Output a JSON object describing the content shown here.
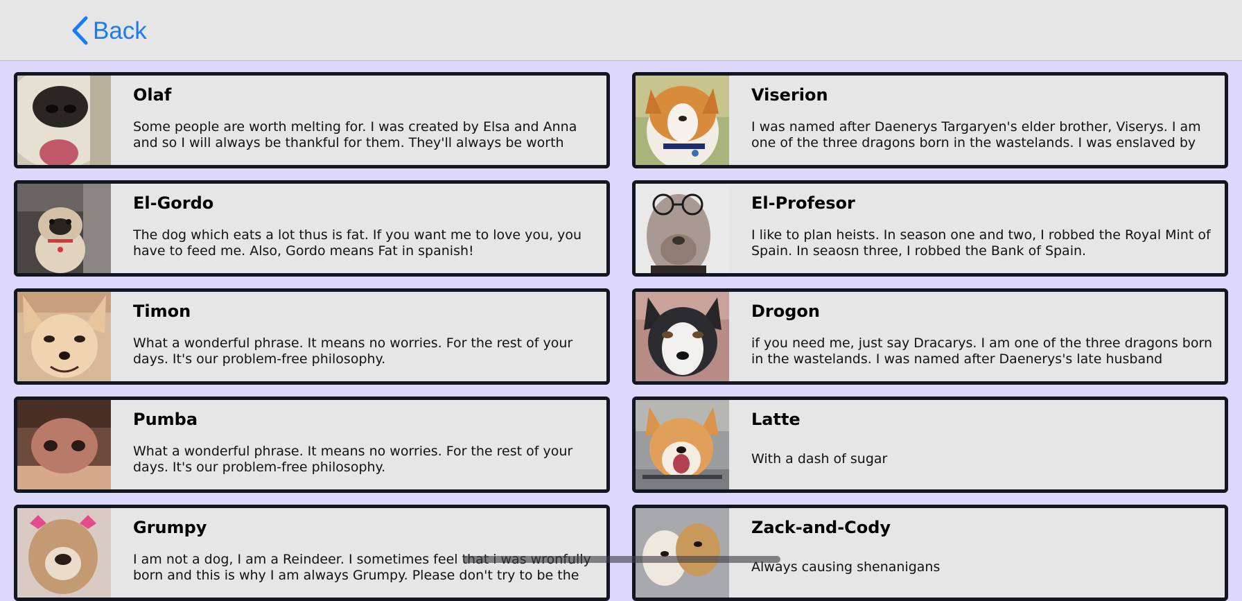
{
  "nav": {
    "back_label": "Back"
  },
  "colors": {
    "background": "#dcd7fb",
    "navbar": "#e6e6e6",
    "accent": "#1a7cf5",
    "card_border": "#13161e",
    "card_background": "#e6e6e6"
  },
  "cards": [
    {
      "name": "Olaf",
      "description": "Some people are worth melting for. I was created by Elsa and Anna and so I will always be thankful for them. They'll always be worth",
      "photo": "white-dog-nose-closeup-photo"
    },
    {
      "name": "Viserion",
      "description": "I was named after Daenerys Targaryen's elder brother, Viserys. I am one of the three dragons born in the wastelands. I was enslaved by",
      "photo": "smiling-corgi-photo"
    },
    {
      "name": "El-Gordo",
      "description": "The dog which eats a lot thus is fat. If you want me to love you, you have to feed me. Also, Gordo means Fat in spanish!",
      "photo": "pug-on-couch-photo"
    },
    {
      "name": "El-Profesor",
      "description": "I like to plan heists. In season one and two, I robbed the Royal Mint of Spain. In seaosn three, I robbed the Bank of Spain.",
      "photo": "shar-pei-with-glasses-photo"
    },
    {
      "name": "Timon",
      "description": "What a wonderful phrase. It means no worries. For the rest of your days. It's our problem-free philosophy.",
      "photo": "chihuahua-photo"
    },
    {
      "name": "Drogon",
      "description": "if you need me, just say Dracarys. I am one of the three dragons born in the wastelands. I was named after Daenerys's late husband",
      "photo": "husky-photo"
    },
    {
      "name": "Pumba",
      "description": "What a wonderful phrase. It means no worries. For the rest of your days. It's our problem-free philosophy.",
      "photo": "dog-snout-closeup-photo"
    },
    {
      "name": "Latte",
      "description": "With a dash of sugar",
      "photo": "shiba-inu-photo"
    },
    {
      "name": "Grumpy",
      "description": "I am not a dog, I am a Reindeer. I sometimes feel that i was wronfully born and this is why I am always Grumpy. Please don't try to be the",
      "photo": "bulldog-with-bows-photo"
    },
    {
      "name": "Zack-and-Cody",
      "description": "Always causing shenanigans",
      "photo": "two-small-dogs-photo"
    }
  ]
}
